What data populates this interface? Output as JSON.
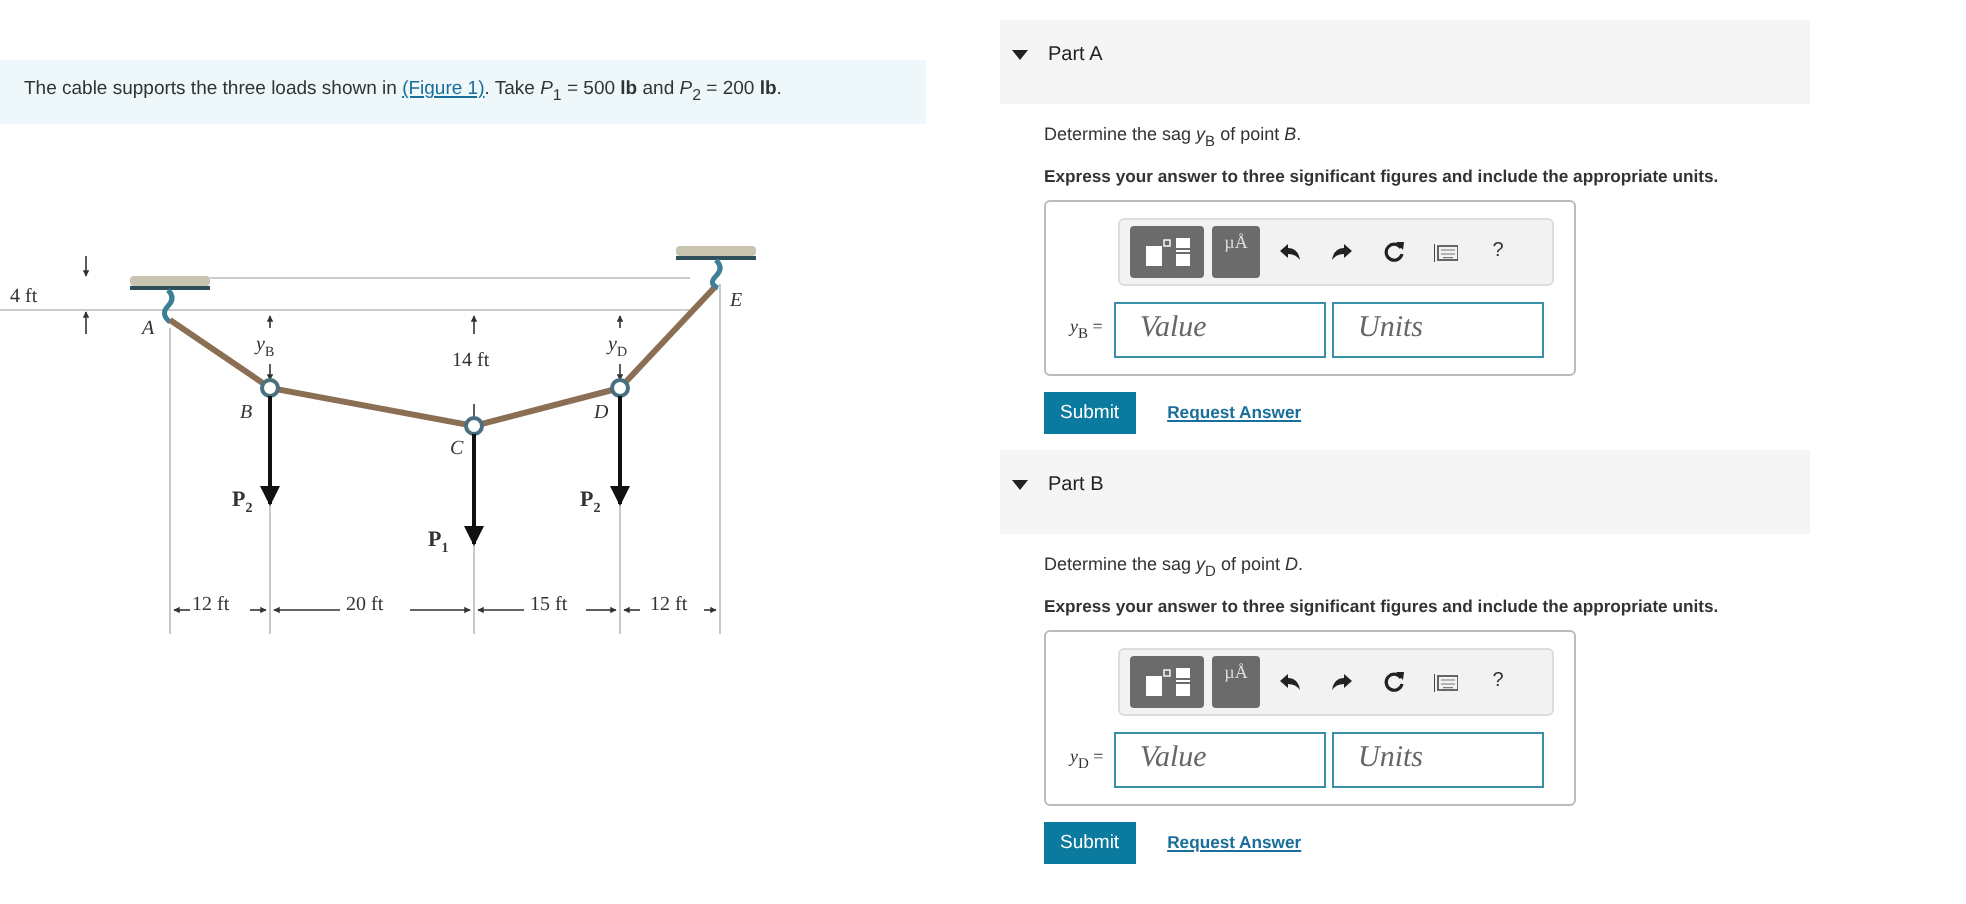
{
  "problem": {
    "before": "The cable supports the three loads shown in ",
    "link": "(Figure 1)",
    "after": ". Take *P*$_{1}$ = 500 **lb** and *P*$_{2}$ = 200 **lb**."
  },
  "figure": {
    "labels": [
      {
        "kind": "dim",
        "text": "4 ft"
      },
      {
        "kind": "point",
        "text": "A"
      },
      {
        "kind": "sag",
        "text": "*y*$_{B}$"
      },
      {
        "kind": "dim",
        "text": "14 ft"
      },
      {
        "kind": "sag",
        "text": "*y*$_{D}$"
      },
      {
        "kind": "point",
        "text": "E"
      },
      {
        "kind": "point",
        "text": "B"
      },
      {
        "kind": "point",
        "text": "C"
      },
      {
        "kind": "point",
        "text": "D"
      },
      {
        "kind": "load",
        "text": "P$_{2}$"
      },
      {
        "kind": "load",
        "text": "P$_{1}$"
      },
      {
        "kind": "load",
        "text": "P$_{2}$"
      },
      {
        "kind": "dim",
        "text": "12 ft"
      },
      {
        "kind": "dim",
        "text": "20 ft"
      },
      {
        "kind": "dim",
        "text": "15 ft"
      },
      {
        "kind": "dim",
        "text": "12 ft"
      }
    ]
  },
  "parts": [
    {
      "label": "Part A",
      "expanded": true,
      "question": "Determine the sag *y*$_{B}$ of point *B*.",
      "instruction": "Express your answer to three significant figures and include the appropriate units.",
      "toolbar": {
        "units": "µÅ",
        "help": "?"
      },
      "variable": "*y*$_{B}$ =",
      "value": {
        "placeholder": "Value"
      },
      "units": {
        "placeholder": "Units"
      },
      "submit": "Submit",
      "request": "Request Answer"
    },
    {
      "label": "Part B",
      "expanded": true,
      "question": "Determine the sag *y*$_{D}$ of point *D*.",
      "instruction": "Express your answer to three significant figures and include the appropriate units.",
      "toolbar": {
        "units": "µÅ",
        "help": "?"
      },
      "variable": "*y*$_{D}$ =",
      "value": {
        "placeholder": "Value"
      },
      "units": {
        "placeholder": "Units"
      },
      "submit": "Submit",
      "request": "Request Answer"
    }
  ]
}
